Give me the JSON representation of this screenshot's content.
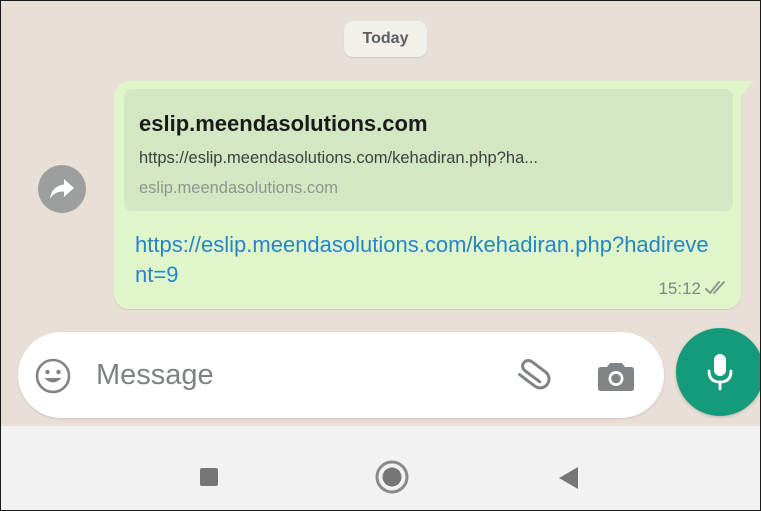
{
  "chat": {
    "date_label": "Today",
    "message": {
      "preview": {
        "title": "eslip.meendasolutions.com",
        "url": "https://eslip.meendasolutions.com/kehadiran.php?ha...",
        "domain": "eslip.meendasolutions.com"
      },
      "link_text": "https://eslip.meendasolutions.com/kehadiran.php?hadirevent=9",
      "time": "15:12",
      "status_icon": "double-check-icon"
    },
    "forward_icon": "forward-arrow-icon"
  },
  "composer": {
    "placeholder": "Message",
    "emoji_icon": "emoji-icon",
    "attach_icon": "paperclip-icon",
    "camera_icon": "camera-icon",
    "mic_icon": "microphone-icon"
  },
  "nav": {
    "recents_icon": "recents-square-icon",
    "home_icon": "home-circle-icon",
    "back_icon": "back-triangle-icon"
  },
  "colors": {
    "chat_background": "#e8e0d6",
    "outgoing_bubble": "#e1f5cb",
    "link_blue": "#2785c7",
    "accent_green": "#159a7c"
  }
}
